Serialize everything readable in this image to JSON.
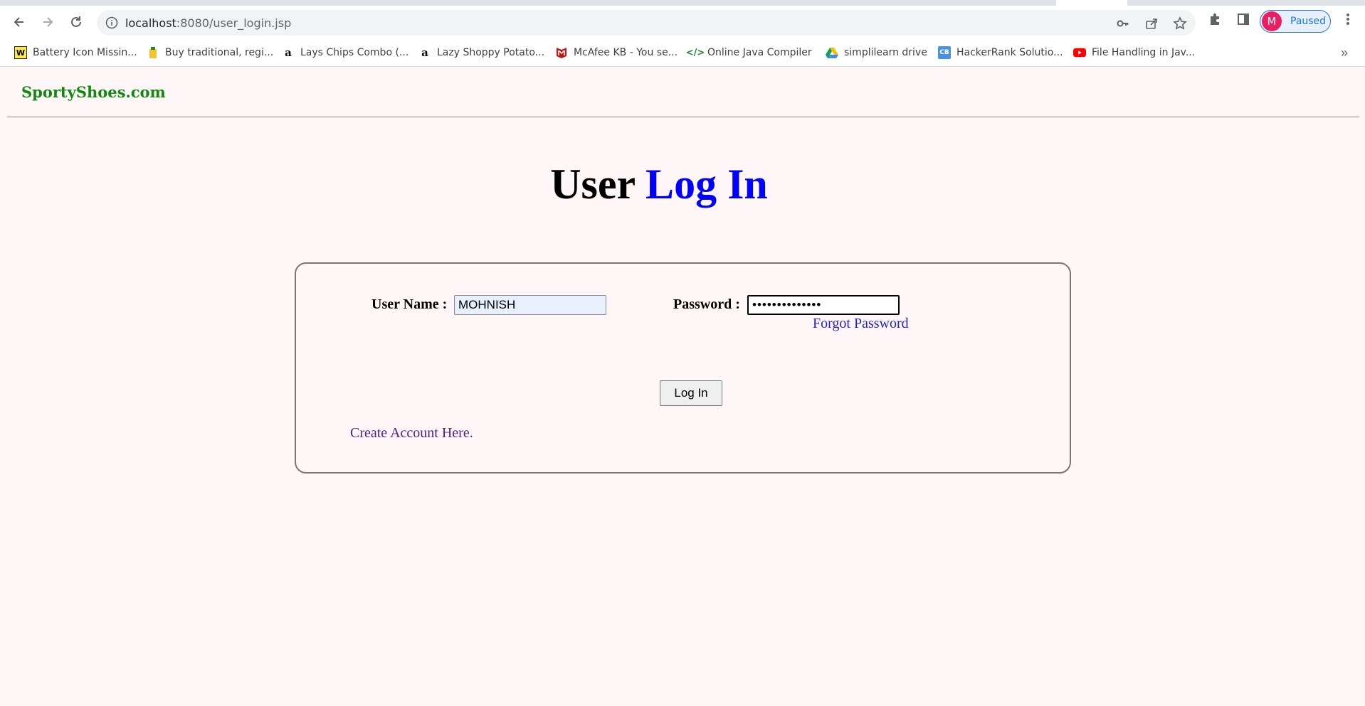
{
  "browser": {
    "url_host": "localhost",
    "url_path": ":8080/user_login.jsp",
    "profile_initial": "M",
    "profile_status": "Paused",
    "bookmarks": [
      {
        "label": "Battery Icon Missin...",
        "icon": "w-icon"
      },
      {
        "label": "Buy traditional, regi...",
        "icon": "shop-icon"
      },
      {
        "label": "Lays Chips Combo (...",
        "icon": "amazon-icon"
      },
      {
        "label": "Lazy Shoppy Potato...",
        "icon": "amazon-icon"
      },
      {
        "label": "McAfee KB - You se...",
        "icon": "mcafee-icon"
      },
      {
        "label": "Online Java Compiler",
        "icon": "code-icon"
      },
      {
        "label": "simplilearn drive",
        "icon": "drive-icon"
      },
      {
        "label": "HackerRank Solutio...",
        "icon": "cb-icon"
      },
      {
        "label": "File Handling in Jav...",
        "icon": "youtube-icon"
      }
    ],
    "bookmarks_more": "»"
  },
  "page": {
    "brand": "SportyShoes.com",
    "heading_part1": "User ",
    "heading_part2": "Log In"
  },
  "form": {
    "username_label": "User Name :",
    "username_value": "MOHNISH",
    "password_label": "Password :",
    "password_value": "••••••••••••••",
    "forgot_password": "Forgot Password",
    "login_button": "Log In",
    "create_account": "Create Account Here."
  },
  "colors": {
    "brand": "#118811",
    "heading_accent": "#0000ff",
    "page_background": "#fff7f7"
  }
}
